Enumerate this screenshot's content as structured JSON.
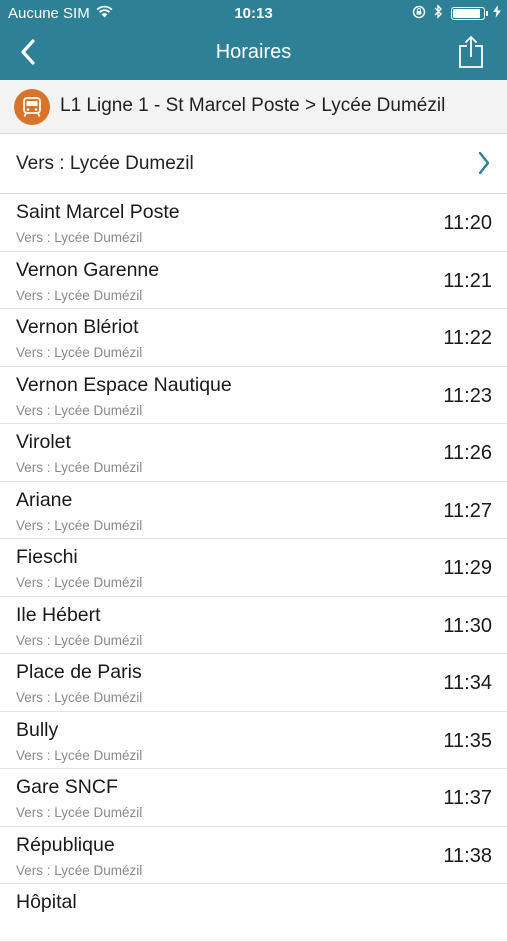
{
  "status_bar": {
    "carrier": "Aucune SIM",
    "time": "10:13",
    "battery_level": 0.9
  },
  "nav": {
    "title": "Horaires",
    "back_icon": "chevron-left-icon",
    "share_icon": "share-icon"
  },
  "line": {
    "label": "L1 Ligne 1 - St Marcel Poste > Lycée Dumézil",
    "icon": "bus-icon",
    "icon_color": "#d9732a"
  },
  "direction": {
    "label": "Vers : Lycée Dumezil"
  },
  "colors": {
    "header": "#2e8096"
  },
  "stops": [
    {
      "name": "Saint Marcel Poste",
      "direction": "Vers : Lycée Dumézil",
      "time": "11:20"
    },
    {
      "name": "Vernon Garenne",
      "direction": "Vers : Lycée Dumézil",
      "time": "11:21"
    },
    {
      "name": "Vernon Blériot",
      "direction": "Vers : Lycée Dumézil",
      "time": "11:22"
    },
    {
      "name": "Vernon Espace Nautique",
      "direction": "Vers : Lycée Dumézil",
      "time": "11:23"
    },
    {
      "name": "Virolet",
      "direction": "Vers : Lycée Dumézil",
      "time": "11:26"
    },
    {
      "name": "Ariane",
      "direction": "Vers : Lycée Dumézil",
      "time": "11:27"
    },
    {
      "name": "Fieschi",
      "direction": "Vers : Lycée Dumézil",
      "time": "11:29"
    },
    {
      "name": "Ile Hébert",
      "direction": "Vers : Lycée Dumézil",
      "time": "11:30"
    },
    {
      "name": "Place de Paris",
      "direction": "Vers : Lycée Dumézil",
      "time": "11:34"
    },
    {
      "name": "Bully",
      "direction": "Vers : Lycée Dumézil",
      "time": "11:35"
    },
    {
      "name": "Gare SNCF",
      "direction": "Vers : Lycée Dumézil",
      "time": "11:37"
    },
    {
      "name": "République",
      "direction": "Vers : Lycée Dumézil",
      "time": "11:38"
    },
    {
      "name": "Hôpital",
      "direction": "",
      "time": ""
    }
  ]
}
